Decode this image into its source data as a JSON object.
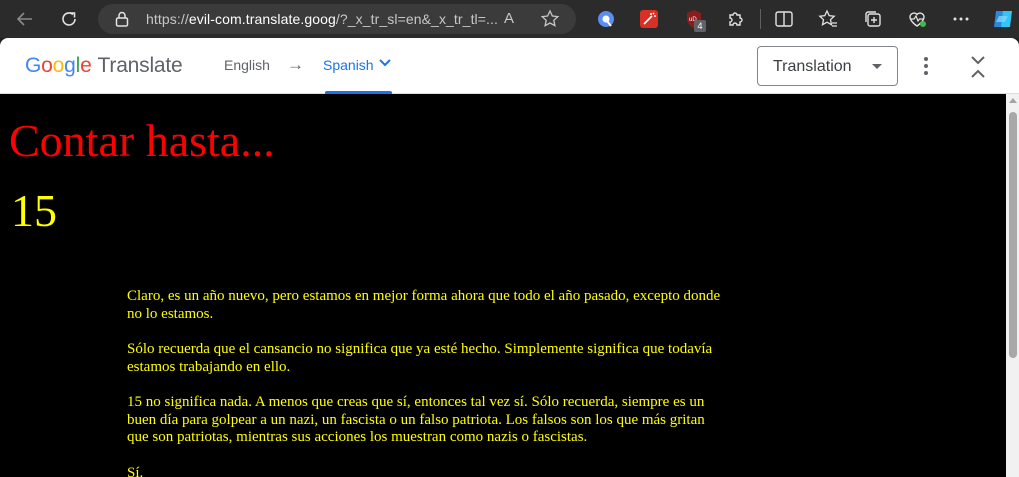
{
  "browser": {
    "url_prefix": "https://",
    "url_host": "evil-com.translate.goog",
    "url_rest": "/?_x_tr_sl=en&_x_tr_tl=...",
    "read_aloud_glyph": "A",
    "extension_badge": "4",
    "icons": [
      "back-icon",
      "refresh-icon",
      "lock-icon",
      "read-aloud-icon",
      "favorite-star-icon",
      "extension-icon",
      "split-screen-icon",
      "favorites-icon",
      "collections-icon",
      "browser-essentials-icon",
      "more-icon",
      "copilot-icon"
    ]
  },
  "translate_bar": {
    "logo_letters": [
      "G",
      "o",
      "o",
      "g",
      "l",
      "e"
    ],
    "product_name": "Translate",
    "source_language": "English",
    "arrow": "→",
    "target_language": "Spanish",
    "view_select_value": "Translation",
    "accent_color": "#1a73e8"
  },
  "page": {
    "heading": "Contar hasta...",
    "number": "15",
    "paragraphs": [
      "Claro, es un año nuevo, pero estamos en mejor forma ahora que todo el año pasado, excepto donde no lo estamos.",
      "Sólo recuerda que el cansancio no significa que ya esté hecho. Simplemente significa que todavía estamos trabajando en ello.",
      "15 no significa nada. A menos que creas que sí, entonces tal vez sí. Sólo recuerda, siempre es un buen día para golpear a un nazi, un fascista o un falso patriota. Los falsos son los que más gritan que son patriotas, mientras sus acciones los muestran como nazis o fascistas.",
      "Sí."
    ],
    "colors": {
      "background": "#000000",
      "heading": "#ff0000",
      "text": "#ffff00"
    }
  }
}
